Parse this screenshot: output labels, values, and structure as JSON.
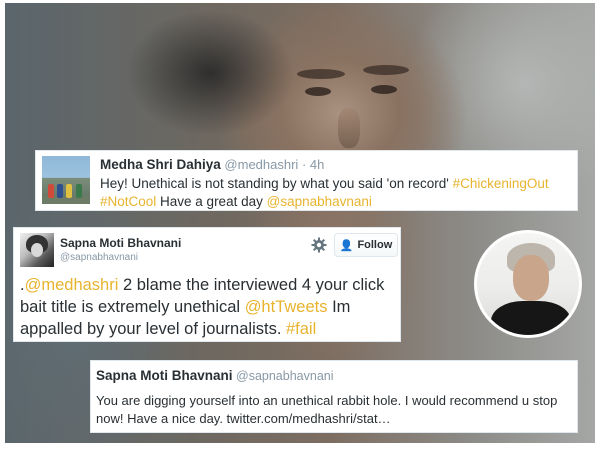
{
  "tweets": {
    "first": {
      "author_name": "Medha Shri Dahiya",
      "author_handle": "@medhashri",
      "separator": "·",
      "time": "4h",
      "text_plain_1": "Hey! Unethical is not standing by what you said 'on record' ",
      "hashtag_1": "#ChickeningOut",
      "hashtag_2": "#NotCool",
      "text_plain_2": " Have a great day ",
      "mention_1": "@sapnabhavnani"
    },
    "second": {
      "author_name": "Sapna Moti Bhavnani",
      "author_handle": "@sapnabhavnani",
      "follow_label": "Follow",
      "text_prefix": ".",
      "mention_1": "@medhashri",
      "text_plain_1": " 2 blame the interviewed 4 your click bait title is extremely unethical ",
      "mention_2": "@htTweets",
      "text_plain_2": " Im appalled by your level of journalists. ",
      "hashtag_1": "#fail"
    },
    "third": {
      "author_name": "Sapna Moti Bhavnani",
      "author_handle": "@sapnabhavnani",
      "text": "You are digging yourself into an unethical rabbit hole. I would recommend u stop now! Have a nice day.  twitter.com/medhashri/stat…"
    }
  },
  "icons": {
    "gear": "gear-icon",
    "follow": "add-user-icon"
  },
  "colors": {
    "highlight": "#e8b42f",
    "text": "#292f33",
    "muted": "#8899a6",
    "follow_icon": "#55acee"
  }
}
